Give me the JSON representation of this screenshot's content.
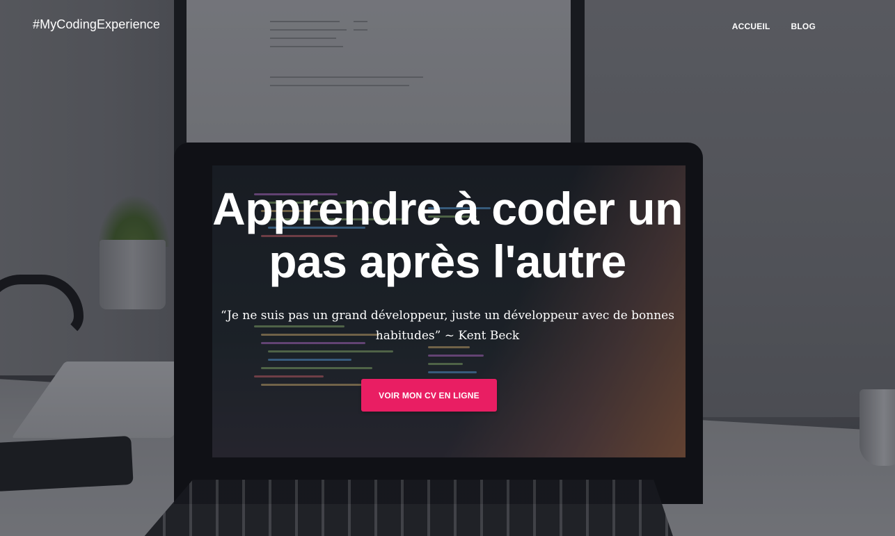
{
  "navbar": {
    "brand": "#MyCodingExperience",
    "links": [
      {
        "label": "ACCUEIL"
      },
      {
        "label": "BLOG"
      }
    ]
  },
  "hero": {
    "title": "Apprendre à coder un pas après l'autre",
    "quote": "“Je ne suis pas un grand développeur, juste un développeur avec de bonnes habitudes” ~ Kent Beck",
    "cta_label": "VOIR MON CV EN LIGNE"
  },
  "colors": {
    "accent": "#e91e63",
    "text": "#ffffff"
  },
  "background": {
    "description_icon": "workspace-laptop-photo"
  }
}
